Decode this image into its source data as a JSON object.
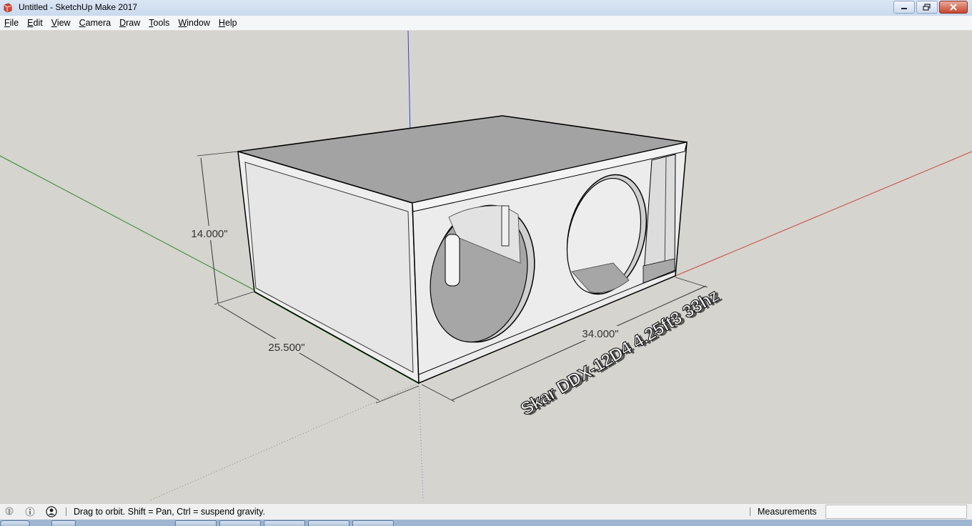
{
  "window": {
    "title": "Untitled - SketchUp Make 2017",
    "controls": [
      "minimize",
      "restore",
      "close"
    ]
  },
  "menu": {
    "items": [
      {
        "label": "File",
        "underline": "F"
      },
      {
        "label": "Edit",
        "underline": "E"
      },
      {
        "label": "View",
        "underline": "V"
      },
      {
        "label": "Camera",
        "underline": "C"
      },
      {
        "label": "Draw",
        "underline": "D"
      },
      {
        "label": "Tools",
        "underline": "T"
      },
      {
        "label": "Window",
        "underline": "W"
      },
      {
        "label": "Help",
        "underline": "H"
      }
    ]
  },
  "viewport": {
    "dimensions": {
      "height": "14.000\"",
      "depth": "25.500\"",
      "width": "34.000\""
    },
    "engraving_text": "Skar DDX-12D4 4.25ft3 33hz",
    "axis_colors": {
      "red": "#c8443a",
      "green": "#2a8a2a",
      "blue": "#3344cc"
    }
  },
  "status": {
    "hint": "Drag to orbit. Shift = Pan, Ctrl = suspend gravity.",
    "measurements_label": "Measurements",
    "measurements_value": ""
  }
}
